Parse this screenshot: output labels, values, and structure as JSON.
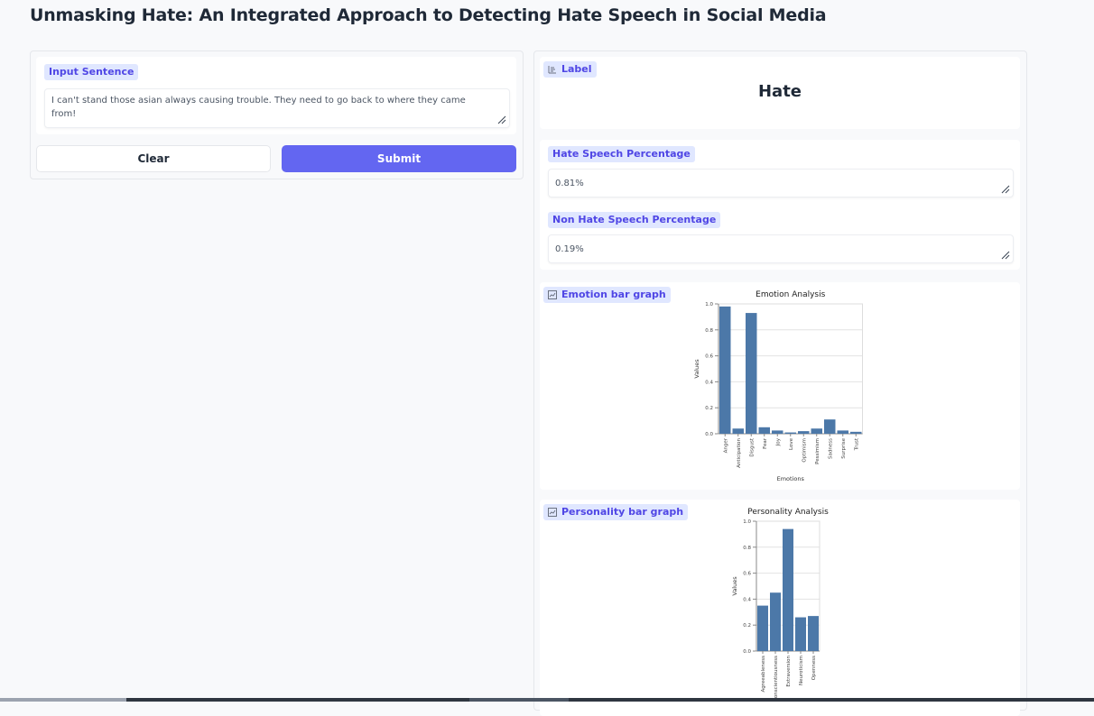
{
  "page": {
    "title": "Unmasking Hate: An Integrated Approach to Detecting Hate Speech in Social Media"
  },
  "input": {
    "label": "Input Sentence",
    "value": "I can't stand those asian always causing trouble. They need to go back to where they came from!"
  },
  "buttons": {
    "clear": "Clear",
    "submit": "Submit"
  },
  "output": {
    "label_title": "Label",
    "label_value": "Hate",
    "hate_title": "Hate Speech Percentage",
    "hate_value": "0.81%",
    "nonhate_title": "Non Hate Speech Percentage",
    "nonhate_value": "0.19%",
    "emotion_title": "Emotion bar graph",
    "personality_title": "Personality bar graph"
  },
  "colors": {
    "accent": "#6366f1",
    "tag_bg": "#e0e7ff",
    "tag_text": "#4f46e5",
    "bar": "#4c78a8"
  },
  "chart_data": [
    {
      "type": "bar",
      "title": "Emotion Analysis",
      "xlabel": "Emotions",
      "ylabel": "Values",
      "ylim": [
        0,
        1.0
      ],
      "yticks": [
        "0.0",
        "0.2",
        "0.4",
        "0.6",
        "0.8",
        "1.0"
      ],
      "categories": [
        "Anger",
        "Anticipation",
        "Disgust",
        "Fear",
        "Joy",
        "Love",
        "Optimism",
        "Pessimism",
        "Sadness",
        "Surprise",
        "Trust"
      ],
      "values": [
        0.98,
        0.04,
        0.93,
        0.05,
        0.025,
        0.01,
        0.02,
        0.04,
        0.11,
        0.025,
        0.015
      ],
      "grid": true
    },
    {
      "type": "bar",
      "title": "Personality Analysis",
      "xlabel": "",
      "ylabel": "Values",
      "ylim": [
        0,
        1.0
      ],
      "yticks": [
        "0.0",
        "0.2",
        "0.4",
        "0.6",
        "0.8",
        "1.0"
      ],
      "categories": [
        "Agreeableness",
        "Conscientiousness",
        "Extraversion",
        "Neuroticism",
        "Openness"
      ],
      "values": [
        0.35,
        0.45,
        0.94,
        0.26,
        0.27
      ],
      "grid": true
    }
  ]
}
